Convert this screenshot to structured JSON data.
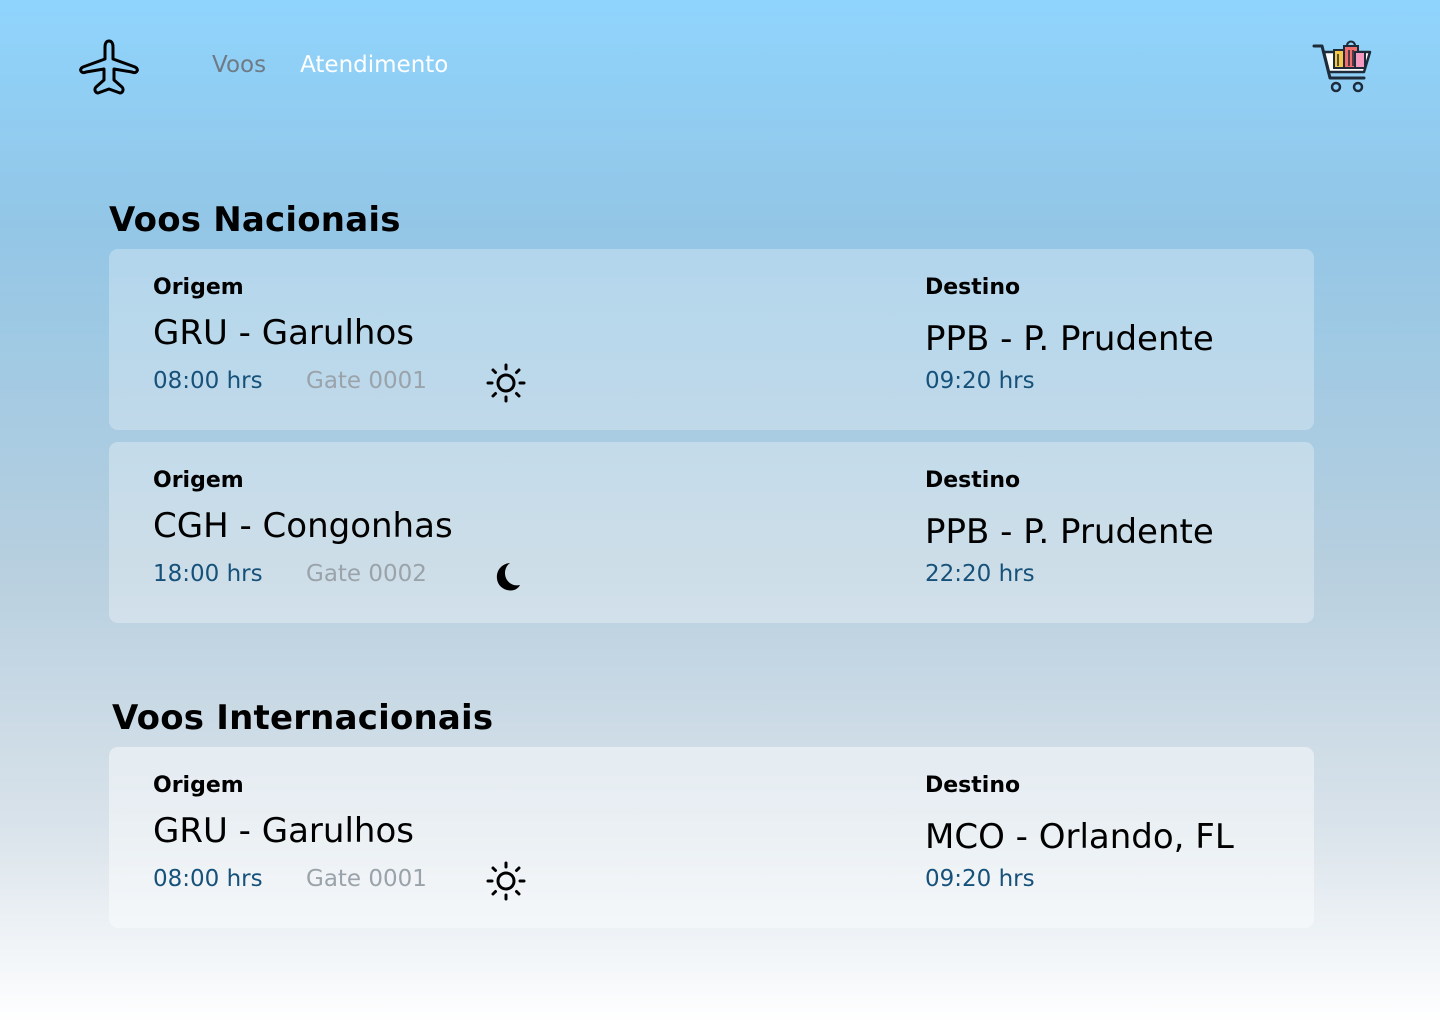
{
  "nav": {
    "voos": "Voos",
    "atendimento": "Atendimento"
  },
  "icons": {
    "logo": "airplane-icon",
    "cart": "shopping-cart-icon",
    "day": "sun-icon",
    "night": "moon-icon"
  },
  "sections": {
    "nacionais": {
      "title": "Voos Nacionais",
      "flights": [
        {
          "origin_label": "Origem",
          "origin": "GRU - Garulhos",
          "departure": "08:00 hrs",
          "gate": "Gate 0001",
          "period_icon": "sun-icon",
          "dest_label": "Destino",
          "destination": "PPB - P. Prudente",
          "arrival": "09:20 hrs"
        },
        {
          "origin_label": "Origem",
          "origin": "CGH - Congonhas",
          "departure": "18:00 hrs",
          "gate": "Gate 0002",
          "period_icon": "moon-icon",
          "dest_label": "Destino",
          "destination": "PPB - P. Prudente",
          "arrival": "22:20 hrs"
        }
      ]
    },
    "internacionais": {
      "title": "Voos Internacionais",
      "flights": [
        {
          "origin_label": "Origem",
          "origin": "GRU - Garulhos",
          "departure": "08:00 hrs",
          "gate": "Gate 0001",
          "period_icon": "sun-icon",
          "dest_label": "Destino",
          "destination": "MCO - Orlando, FL",
          "arrival": "09:20 hrs"
        }
      ]
    }
  },
  "colors": {
    "time": "#16517a",
    "gate": "#9aa3aa",
    "nav_active": "#ffffff",
    "nav_inactive": "#6e7a84"
  }
}
